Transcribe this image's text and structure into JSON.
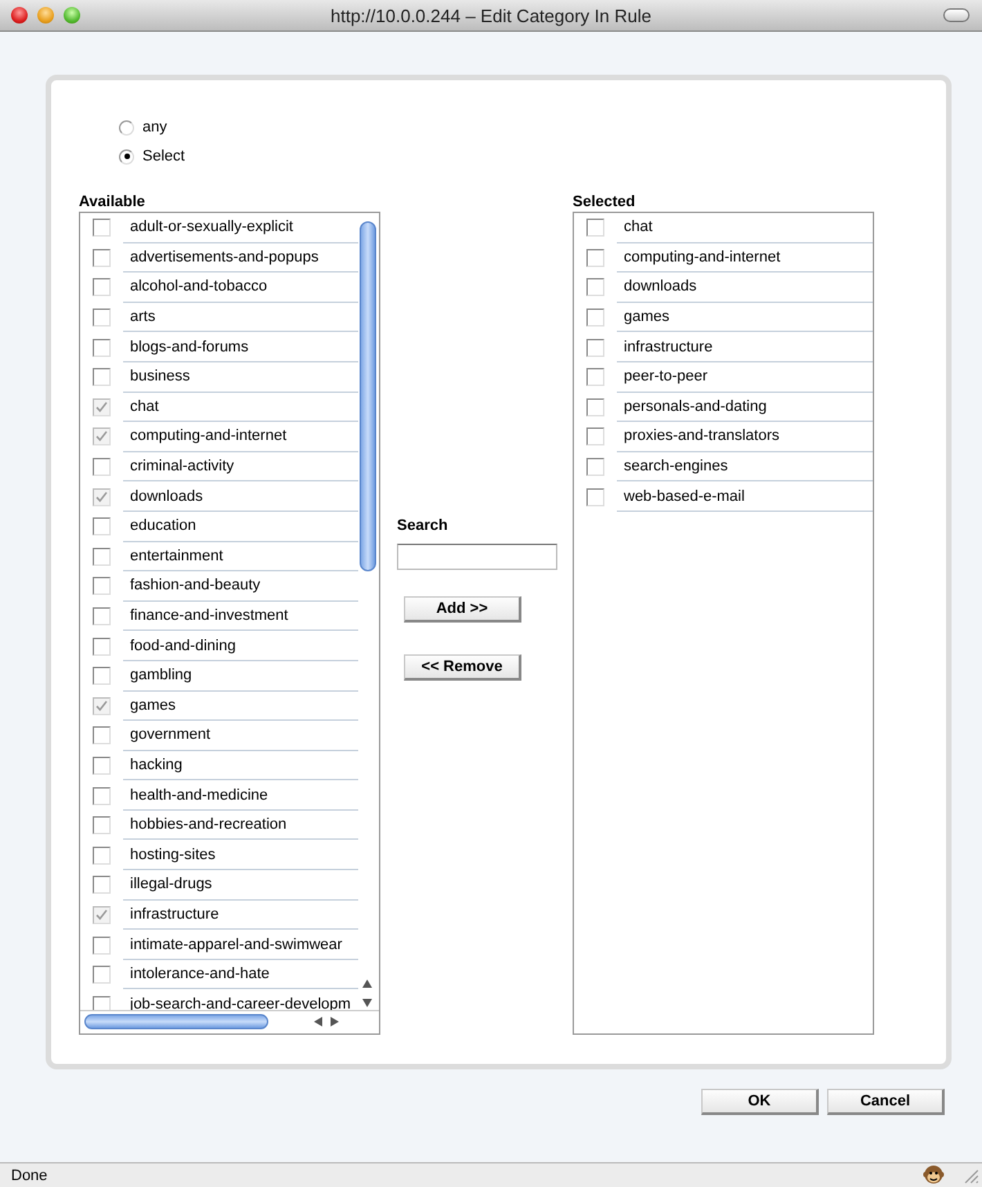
{
  "window": {
    "title": "http://10.0.0.244 – Edit Category In Rule"
  },
  "match": [
    {
      "label": "any",
      "selected": false
    },
    {
      "label": "Select",
      "selected": true
    }
  ],
  "available": {
    "label": "Available",
    "items": [
      {
        "label": "adult-or-sexually-explicit",
        "checked": false
      },
      {
        "label": "advertisements-and-popups",
        "checked": false
      },
      {
        "label": "alcohol-and-tobacco",
        "checked": false
      },
      {
        "label": "arts",
        "checked": false
      },
      {
        "label": "blogs-and-forums",
        "checked": false
      },
      {
        "label": "business",
        "checked": false
      },
      {
        "label": "chat",
        "checked": true
      },
      {
        "label": "computing-and-internet",
        "checked": true
      },
      {
        "label": "criminal-activity",
        "checked": false
      },
      {
        "label": "downloads",
        "checked": true
      },
      {
        "label": "education",
        "checked": false
      },
      {
        "label": "entertainment",
        "checked": false
      },
      {
        "label": "fashion-and-beauty",
        "checked": false
      },
      {
        "label": "finance-and-investment",
        "checked": false
      },
      {
        "label": "food-and-dining",
        "checked": false
      },
      {
        "label": "gambling",
        "checked": false
      },
      {
        "label": "games",
        "checked": true
      },
      {
        "label": "government",
        "checked": false
      },
      {
        "label": "hacking",
        "checked": false
      },
      {
        "label": "health-and-medicine",
        "checked": false
      },
      {
        "label": "hobbies-and-recreation",
        "checked": false
      },
      {
        "label": "hosting-sites",
        "checked": false
      },
      {
        "label": "illegal-drugs",
        "checked": false
      },
      {
        "label": "infrastructure",
        "checked": true
      },
      {
        "label": "intimate-apparel-and-swimwear",
        "checked": false
      },
      {
        "label": "intolerance-and-hate",
        "checked": false
      },
      {
        "label": "job-search-and-career-developm",
        "checked": false
      }
    ]
  },
  "search": {
    "label": "Search"
  },
  "actions": [
    "Add >>",
    "<< Remove"
  ],
  "selected": {
    "label": "Selected",
    "items": [
      {
        "label": "chat",
        "checked": false
      },
      {
        "label": "computing-and-internet",
        "checked": false
      },
      {
        "label": "downloads",
        "checked": false
      },
      {
        "label": "games",
        "checked": false
      },
      {
        "label": "infrastructure",
        "checked": false
      },
      {
        "label": "peer-to-peer",
        "checked": false
      },
      {
        "label": "personals-and-dating",
        "checked": false
      },
      {
        "label": "proxies-and-translators",
        "checked": false
      },
      {
        "label": "search-engines",
        "checked": false
      },
      {
        "label": "web-based-e-mail",
        "checked": false
      }
    ]
  },
  "buttons": [
    "OK",
    "Cancel"
  ],
  "status_bar": {
    "text": "Done"
  }
}
